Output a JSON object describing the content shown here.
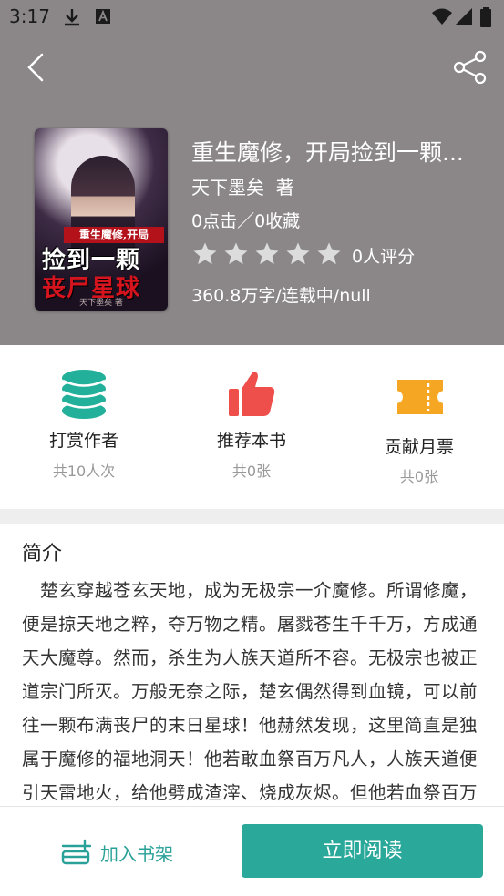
{
  "status_bar": {
    "time": "3:17",
    "icons": [
      "download-icon",
      "text-a-icon",
      "wifi-icon",
      "signal-icon",
      "battery-icon"
    ]
  },
  "header": {
    "back_icon": "chevron-left-icon",
    "share_icon": "share-icon",
    "background_color": "#8b8788"
  },
  "book": {
    "cover": {
      "subtitle": "重生魔修,开局",
      "line1": "捡到一颗",
      "line2": "丧尸星球",
      "author": "天下墨矣 著"
    },
    "title": "重生魔修，开局捡到一颗...",
    "author_line": "天下墨矣  著",
    "stats": "0点击／0收藏",
    "rating": {
      "stars": 5,
      "filled": 0,
      "count_label": "0人评分"
    },
    "meta": "360.8万字/连载中/null"
  },
  "actions": [
    {
      "label": "打赏作者",
      "count": "共10人次",
      "icon": "coins-icon",
      "color": "#23b09a"
    },
    {
      "label": "推荐本书",
      "count": "共0张",
      "icon": "thumbs-up-icon",
      "color": "#ef4f4a"
    },
    {
      "label": "贡献月票",
      "count": "共0张",
      "icon": "ticket-icon",
      "color": "#f5a623"
    }
  ],
  "intro": {
    "title": "简介",
    "text": "楚玄穿越苍玄天地，成为无极宗一介魔修。所谓修魔，便是掠天地之粹，夺万物之精。屠戮苍生千千万，方成通天大魔尊。然而，杀生为人族天道所不容。无极宗也被正道宗门所灭。万般无奈之际，楚玄偶然得到血镜，可以前往一颗布满丧尸的末日星球！他赫然发现，这里简直是独属于魔修的福地洞天！他若敢血祭百万凡人，人族天道便引天雷地火，给他劈成渣滓、烧成灰烬。但他若血祭百万"
  },
  "bottom": {
    "shelf_label": "加入书架",
    "read_label": "立即阅读",
    "accent": "#2aa99a"
  }
}
